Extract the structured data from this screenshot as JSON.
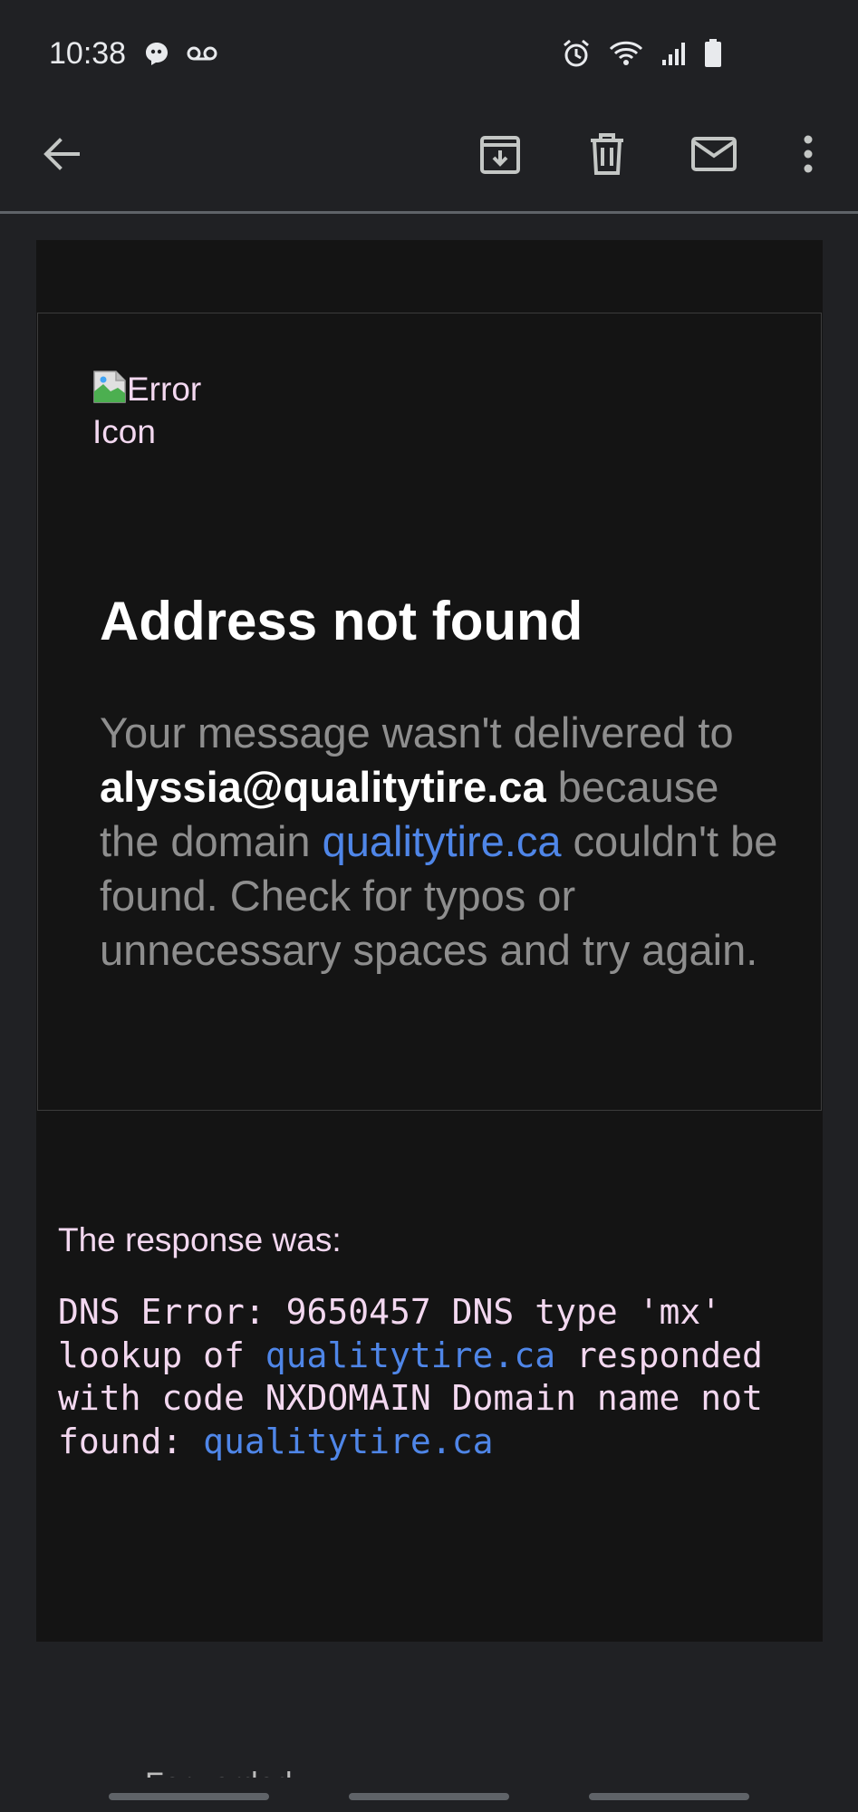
{
  "status_bar": {
    "time": "10:38",
    "left_icons": [
      "chat-bubble-icon",
      "voicemail-icon"
    ],
    "right_icons": [
      "alarm-icon",
      "wifi-icon",
      "signal-icon",
      "battery-icon"
    ]
  },
  "toolbar": {
    "icons": [
      "back-arrow-icon",
      "archive-icon",
      "delete-icon",
      "mark-unread-icon",
      "more-vert-icon"
    ]
  },
  "email": {
    "error_image_alt": "Error Icon",
    "title": "Address not found",
    "message_part1": "Your message wasn't delivered to ",
    "recipient": "alyssia@qualitytire.ca",
    "message_part2": " because the domain ",
    "domain_link": "qualitytire.ca",
    "message_part3": " couldn't be found. Check for typos or unnecessary spaces and try again.",
    "response_label": "The response was:",
    "response_part1": "DNS Error: 9650457 DNS type 'mx' lookup of ",
    "response_link1": "qualitytire.ca",
    "response_part2": " responded with code NXDOMAIN Domain name not found: ",
    "response_link2": "qualitytire.ca",
    "partial_footer": "Forwarded"
  },
  "colors": {
    "background": "#202124",
    "email_background": "#141414",
    "link": "#4f86e8",
    "pink_text": "#f3d8f0"
  }
}
